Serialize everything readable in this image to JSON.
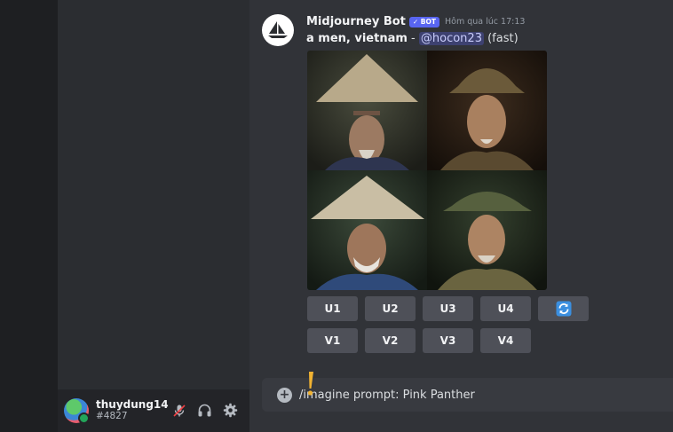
{
  "user": {
    "username": "thuydung14",
    "tag": "#4827"
  },
  "message": {
    "author": "Midjourney Bot",
    "badge": "✓ BOT",
    "timestamp": "Hôm qua lúc 17:13",
    "prompt": "a men, vietnam",
    "separator": " - ",
    "mention": "@hocon23",
    "mode": "(fast)"
  },
  "upscale_buttons": [
    "U1",
    "U2",
    "U3",
    "U4"
  ],
  "variation_buttons": [
    "V1",
    "V2",
    "V3",
    "V4"
  ],
  "composer": {
    "text": "/imagine prompt: Pink Panther"
  },
  "colors": {
    "accent": "#5865f2",
    "refresh": "#3b8fe0",
    "alert": "#f0b232"
  },
  "icons": {
    "refresh": "refresh-icon",
    "mic": "mic-muted-icon",
    "headset": "headset-icon",
    "settings": "gear-icon",
    "add": "plus-icon"
  }
}
